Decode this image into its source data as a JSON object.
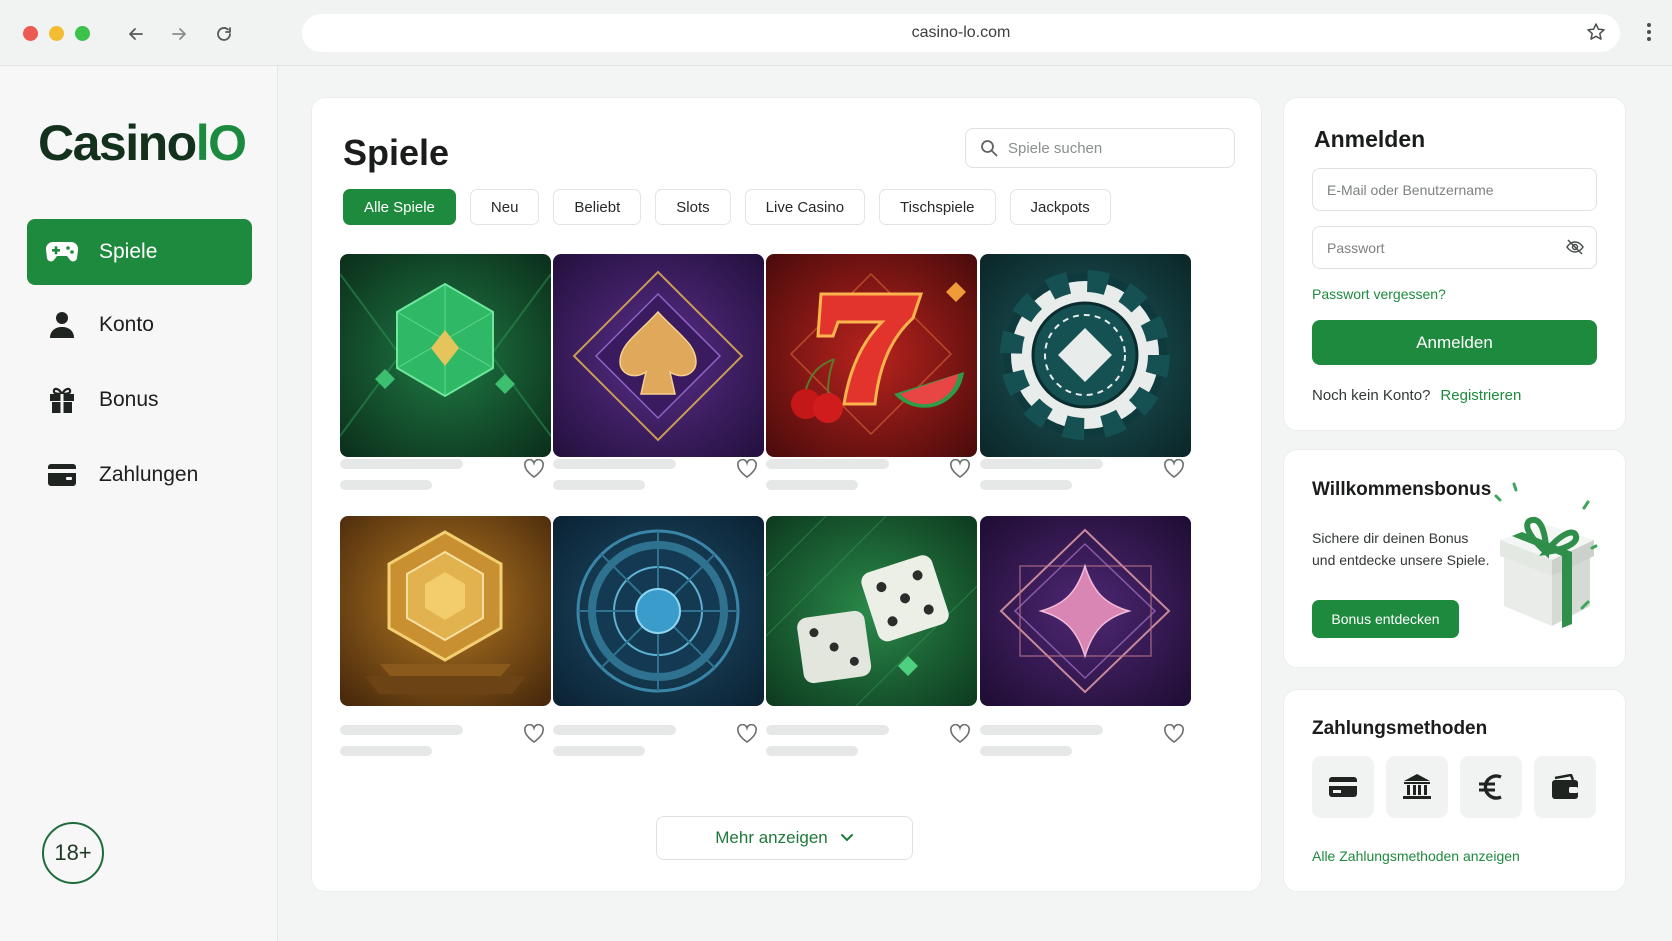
{
  "browser": {
    "url": "casino-lo.com",
    "colors": {
      "close": "#ec5b52",
      "minimize": "#f4bc32",
      "maximize": "#3cc14a"
    }
  },
  "sidebar": {
    "logo": {
      "prefix": "Casino",
      "suffix": "lO"
    },
    "items": [
      {
        "label": "Spiele",
        "icon": "gamepad-icon",
        "active": true
      },
      {
        "label": "Konto",
        "icon": "user-icon",
        "active": false
      },
      {
        "label": "Bonus",
        "icon": "gift-icon",
        "active": false
      },
      {
        "label": "Zahlungen",
        "icon": "wallet-icon",
        "active": false
      }
    ],
    "age_badge": "18+"
  },
  "main": {
    "title": "Spiele",
    "search_placeholder": "Spiele suchen",
    "filters": [
      {
        "label": "Alle Spiele",
        "active": true
      },
      {
        "label": "Neu"
      },
      {
        "label": "Beliebt"
      },
      {
        "label": "Slots"
      },
      {
        "label": "Live Casino"
      },
      {
        "label": "Tischspiele"
      },
      {
        "label": "Jackpots"
      }
    ],
    "games": [
      {
        "art": "emerald-gem-art"
      },
      {
        "art": "spade-art"
      },
      {
        "art": "lucky-seven-art"
      },
      {
        "art": "poker-chip-art"
      },
      {
        "art": "golden-hexagon-art"
      },
      {
        "art": "roulette-wheel-art"
      },
      {
        "art": "dice-art"
      },
      {
        "art": "pink-diamond-art"
      }
    ],
    "more_button": "Mehr anzeigen"
  },
  "login": {
    "title": "Anmelden",
    "email_placeholder": "E-Mail oder Benutzername",
    "password_placeholder": "Passwort",
    "forgot": "Passwort vergessen?",
    "submit": "Anmelden",
    "no_account": "Noch kein Konto?",
    "register": "Registrieren"
  },
  "bonus": {
    "title": "Willkommensbonus",
    "text": "Sichere dir deinen Bonus und entdecke unsere Spiele.",
    "button": "Bonus entdecken"
  },
  "payments": {
    "title": "Zahlungsmethoden",
    "methods": [
      "credit-card-icon",
      "bank-icon",
      "euro-icon",
      "wallet-icon"
    ],
    "link": "Alle Zahlungsmethoden anzeigen"
  },
  "theme": {
    "accent": "#1e8a3d"
  }
}
